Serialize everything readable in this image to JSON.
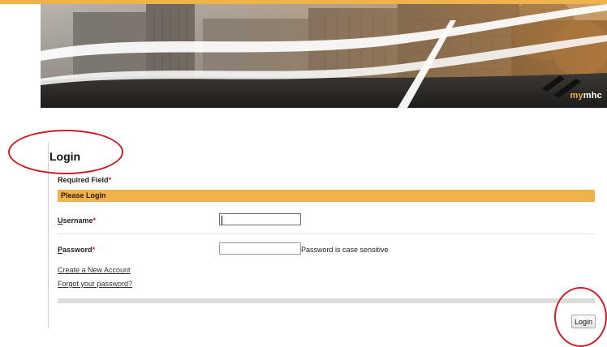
{
  "banner": {
    "brand_prefix": "my",
    "brand_suffix": "mhc",
    "brand_accent_color": "#f0b24a"
  },
  "page": {
    "title": "Login",
    "required_note": "Required Field",
    "required_marker": "*",
    "section_header": "Please Login",
    "accent_color": "#f0b24a"
  },
  "form": {
    "username": {
      "label_first": "U",
      "label_rest": "sername",
      "value": ""
    },
    "password": {
      "label_first": "P",
      "label_rest": "assword",
      "value": "",
      "hint": "Password is case sensitive"
    }
  },
  "links": {
    "create_account": "Create a New Account",
    "forgot_password": "Forgot your password?"
  },
  "actions": {
    "login_label": "Login"
  },
  "annotations": {
    "color": "#c8202a",
    "marks": [
      "title-highlight",
      "login-button-highlight"
    ]
  }
}
